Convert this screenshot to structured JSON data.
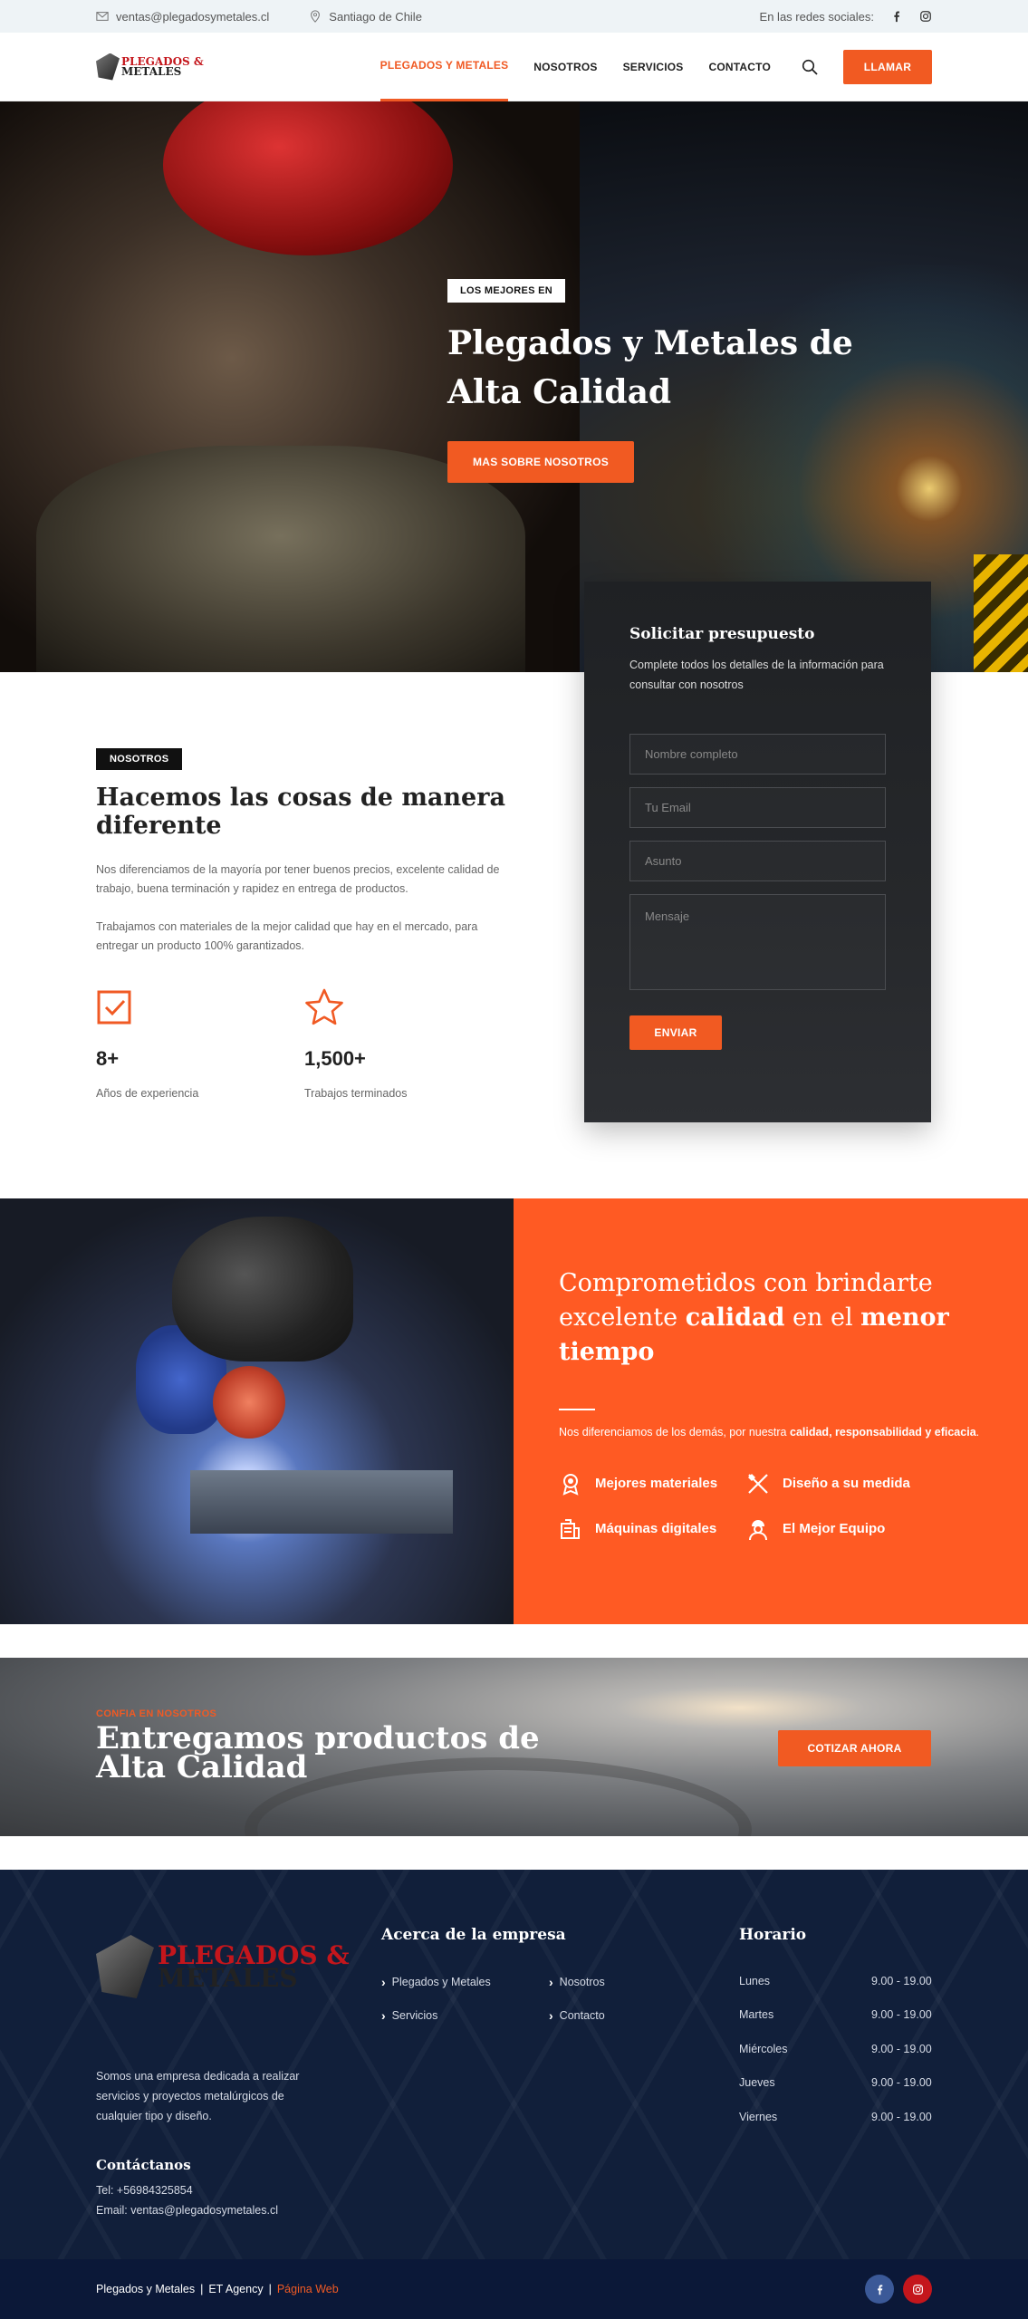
{
  "topbar": {
    "email": "ventas@plegadosymetales.cl",
    "location": "Santiago de Chile",
    "social_label": "En las redes sociales:"
  },
  "logo": {
    "line1": "PLEGADOS &",
    "line2": "METALES"
  },
  "nav": {
    "items": [
      "PLEGADOS Y METALES",
      "NOSOTROS",
      "SERVICIOS",
      "CONTACTO"
    ],
    "active_index": 0,
    "call_label": "LLAMAR"
  },
  "hero": {
    "tag": "LOS MEJORES EN",
    "title_1": "Plegados y ",
    "title_b1": "Metales",
    "title_2": " de ",
    "title_b2": "Alta Calidad",
    "button": "MAS SOBRE NOSOTROS"
  },
  "quote": {
    "title": "Solicitar presupuesto",
    "desc": "Complete todos los detalles de la información para consultar con nosotros",
    "name_placeholder": "Nombre completo",
    "email_placeholder": "Tu Email",
    "subject_placeholder": "Asunto",
    "message_placeholder": "Mensaje",
    "send": "ENVIAR"
  },
  "about": {
    "badge": "NOSOTROS",
    "title_1": "Hacemos las cosas ",
    "title_b": "de manera diferente",
    "p1": "Nos diferenciamos de la mayoría por tener buenos precios, excelente calidad de trabajo, buena terminación y rapidez en entrega de productos.",
    "p2": "Trabajamos con materiales de la mejor calidad que hay en el mercado, para entregar un producto 100% garantizados.",
    "stats": [
      {
        "number": "8+",
        "label": "Años de experiencia",
        "icon": "checkbox-icon"
      },
      {
        "number": "1,500+",
        "label": "Trabajos terminados",
        "icon": "star-icon"
      }
    ]
  },
  "band": {
    "title_1": "Comprometidos con brindarte excelente ",
    "title_b1": "calidad",
    "title_2": " en el ",
    "title_b2": "menor tiempo",
    "desc_1": "Nos diferenciamos de los demás, por nuestra ",
    "desc_b": "calidad, responsabilidad y eficacia",
    "desc_2": ".",
    "features": [
      "Mejores materiales",
      "Diseño a su medida",
      "Máquinas digitales",
      "El Mejor Equipo"
    ]
  },
  "cta": {
    "small": "CONFIA EN NOSOTROS",
    "title_1": "Entregamos productos de ",
    "title_b": "Alta Calidad",
    "button": "COTIZAR AHORA"
  },
  "footer": {
    "about_text": "Somos una empresa dedicada a realizar servicios y proyectos metalúrgicos de cualquier tipo y diseño.",
    "company_heading": "Acerca de la empresa",
    "links": [
      "Plegados y Metales",
      "Nosotros",
      "Servicios",
      "Contacto"
    ],
    "hours_heading": "Horario",
    "hours": [
      {
        "day": "Lunes",
        "time": "9.00 - 19.00"
      },
      {
        "day": "Martes",
        "time": "9.00 - 19.00"
      },
      {
        "day": "Miércoles",
        "time": "9.00 - 19.00"
      },
      {
        "day": "Jueves",
        "time": "9.00 - 19.00"
      },
      {
        "day": "Viernes",
        "time": "9.00 - 19.00"
      }
    ],
    "contact_heading": "Contáctanos",
    "tel": "Tel:  +56984325854",
    "email": "Email: ventas@plegadosymetales.cl"
  },
  "bottom": {
    "brand": "Plegados y Metales",
    "sep": "|",
    "agency": "ET Agency",
    "web": "Página Web"
  },
  "colors": {
    "accent": "#f15a22",
    "footer_bg": "#111f3a",
    "bottom_bg": "#0b1838",
    "facebook": "#3b5998",
    "instagram": "#c4161c"
  }
}
